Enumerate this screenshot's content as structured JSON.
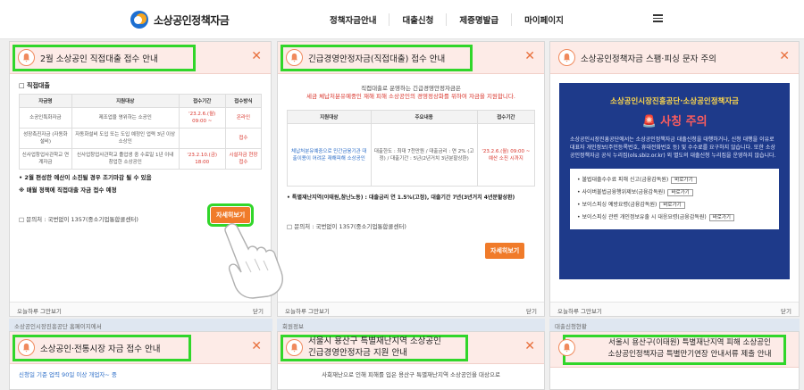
{
  "header": {
    "logo_text": "소상공인정책자금",
    "nav": [
      "정책자금안내",
      "대출신청",
      "제증명발급",
      "마이페이지"
    ]
  },
  "colors": {
    "highlight": "#31d62a",
    "header_bg": "#fdebe7",
    "accent": "#f07b2a",
    "dark_panel": "#1e3a8a"
  },
  "popup1": {
    "title": "2월 소상공인 직접대출 접수 안내",
    "section": "□ 직접대출",
    "table_headers": [
      "자금명",
      "지원대상",
      "접수기간",
      "접수방식"
    ],
    "rows": [
      [
        "소공인특화자금",
        "제조업을 영위하는 소공인",
        "'23.2.6.(월) 09:00 ~",
        "온라인"
      ],
      [
        "성장촉진자금 (자동화설비)",
        "자동화설비 도입 또는 도입 예정인 업력 3년 이상 소상인",
        "",
        "접수"
      ],
      [
        "신사업창업사관학교 연계자금",
        "신사업창업사관학교 졸업생 중 수료일 1년 이내 창업한 소상공인",
        "'23.2.10.(금) 18:00",
        "시설자금 현장 접수"
      ]
    ],
    "notice1": "• 2월 편성한 예산이 소진될 경우 조기마감 될 수 있음",
    "notice2": "※ 매월 정책에 직접대출 자금 접수 예정",
    "contact": "□ 문의처 : 국번없이 1357(중소기업통합콜센터)",
    "detail_btn": "자세히보기",
    "footer_left": "오늘하루 그만보기",
    "footer_right": "닫기"
  },
  "popup2": {
    "title": "긴급경영안정자금(직접대출) 접수 안내",
    "intro1": "직접대출로 운영하는 긴급경영안정자금은",
    "intro2": "세금 체납처분유예중인 재해 피해 소상공인의 경영정상화를 위하여 자금을 지원합니다.",
    "headers": [
      "지원대상",
      "주요내용",
      "접수기간"
    ],
    "target": "체납처분유예중으로 민간금융기관 대출이용이 어려운 재해피해 소상공인",
    "content": "대출한도 : 최대 7천만원 / 대출금리 : 연 2% (고정) / 대출기간 : 5년(2년거치 3년분할상환)",
    "period": "'23.2.6.(월) 09:00 ~ 예산 소진 시까지",
    "extra": "• 특별재난지역(이태원,참난노동) : 대출금리 연 1.5%(고정), 대출기간 7년(3년거치 4년분할상환)",
    "contact": "□ 문의처 : 국번없이 1357(중소기업통합콜센터)",
    "detail_btn": "자세히보기",
    "footer_left": "오늘하루 그만보기",
    "footer_right": "닫기"
  },
  "popup3": {
    "title": "소상공인정책자금 스팸·피싱 문자 주의",
    "dark_title": "소상공인시장진흥공단·소상공인정책자금",
    "warn": "사칭 주의",
    "text": "소상공인시장진흥공단에서는 소상공인정책자금 대출신청을 대행하거나, 신청 대행을 이유로 대표자 개인정보(주민등록번호, 휴대전화번호 등) 및 수수료를 요구하지 않습니다. 또한 소상공인정책자금 공식 누리집(ols.sbiz.or.kr) 외 별도의 대출신청 누리집을 운영하지 않습니다.",
    "links": [
      "• 불법대출수수료 피해 신고(금융감독원)",
      "• 사이버불법금융행위제보(금융감독원)",
      "• 보이스피싱 예방요령(금융감독원)",
      "• 보이스피싱 관련 개인정보유출 시 대응요령(금융감독원)"
    ],
    "link_btn": "바로가기",
    "footer_left": "오늘하루 그만보기",
    "footer_right": "닫기"
  },
  "popup4": {
    "title": "소상공인·전통시장 자금 접수 안내",
    "line1": "신청일 기준 업력 90일 이상 개업자~ 중"
  },
  "popup5": {
    "title1": "서울시 용산구 특별재난지역 소상공인",
    "title2": "긴급경영안정자금 지원 안내",
    "line1": "사회재난으로 인해 피해를 입은 용산구 특별재난지역 소상공인을 대상으로"
  },
  "popup6": {
    "title1": "서울시 용산구(이태원) 특별재난지역 피해 소상공인",
    "title2": "소상공인정책자금 특별만기연장 안내서류 제출 안내"
  },
  "bg": {
    "strip1": "소상공인시장진흥공단 홈페이지에서",
    "strip2": "회원정보",
    "strip3": "대출정보",
    "strip4": "대출신청현황"
  }
}
